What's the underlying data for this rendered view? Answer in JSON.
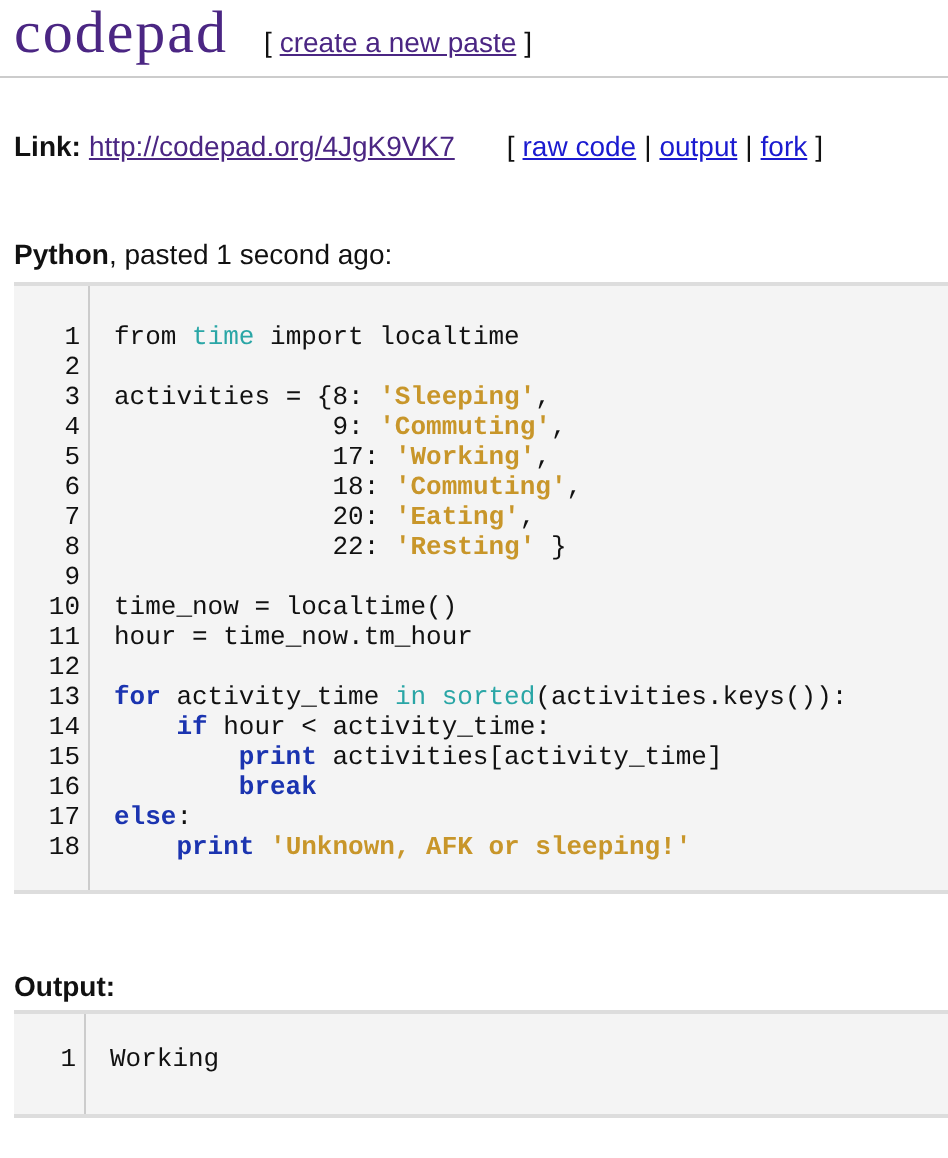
{
  "header": {
    "logo": "codepad",
    "bracket_open": "[",
    "new_paste_link": "create a new paste",
    "bracket_close": "]"
  },
  "link_row": {
    "label": "Link:",
    "url": "http://codepad.org/4JgK9VK7",
    "bracket_open": "[",
    "links": [
      {
        "text": "raw code"
      },
      {
        "text": "output"
      },
      {
        "text": "fork"
      }
    ],
    "separators": [
      "|",
      "|"
    ],
    "bracket_close": "]"
  },
  "paste_info": {
    "language": "Python",
    "rest": ", pasted 1 second ago:"
  },
  "code": {
    "lines": [
      {
        "number": "1",
        "tokens": [
          {
            "kind": "plain",
            "text": "from "
          },
          {
            "kind": "builtin",
            "text": "time"
          },
          {
            "kind": "plain",
            "text": " import localtime"
          }
        ]
      },
      {
        "number": "2"
      },
      {
        "number": "3",
        "tokens": [
          {
            "kind": "plain",
            "text": "activities = {8: "
          },
          {
            "kind": "string",
            "text": "'Sleeping'"
          },
          {
            "kind": "plain",
            "text": ","
          }
        ]
      },
      {
        "number": "4",
        "tokens": [
          {
            "kind": "plain",
            "text": "              9: "
          },
          {
            "kind": "string",
            "text": "'Commuting'"
          },
          {
            "kind": "plain",
            "text": ","
          }
        ]
      },
      {
        "number": "5",
        "tokens": [
          {
            "kind": "plain",
            "text": "              17: "
          },
          {
            "kind": "string",
            "text": "'Working'"
          },
          {
            "kind": "plain",
            "text": ","
          }
        ]
      },
      {
        "number": "6",
        "tokens": [
          {
            "kind": "plain",
            "text": "              18: "
          },
          {
            "kind": "string",
            "text": "'Commuting'"
          },
          {
            "kind": "plain",
            "text": ","
          }
        ]
      },
      {
        "number": "7",
        "tokens": [
          {
            "kind": "plain",
            "text": "              20: "
          },
          {
            "kind": "string",
            "text": "'Eating'"
          },
          {
            "kind": "plain",
            "text": ","
          }
        ]
      },
      {
        "number": "8",
        "tokens": [
          {
            "kind": "plain",
            "text": "              22: "
          },
          {
            "kind": "string",
            "text": "'Resting'"
          },
          {
            "kind": "plain",
            "text": " }"
          }
        ]
      },
      {
        "number": "9"
      },
      {
        "number": "10",
        "tokens": [
          {
            "kind": "plain",
            "text": "time_now = localtime()"
          }
        ]
      },
      {
        "number": "11",
        "tokens": [
          {
            "kind": "plain",
            "text": "hour = time_now.tm_hour"
          }
        ]
      },
      {
        "number": "12"
      },
      {
        "number": "13",
        "tokens": [
          {
            "kind": "keyword",
            "text": "for"
          },
          {
            "kind": "plain",
            "text": " activity_time "
          },
          {
            "kind": "builtin",
            "text": "in sorted"
          },
          {
            "kind": "plain",
            "text": "(activities.keys()):"
          }
        ],
        "children": [
          {
            "number": "14",
            "tokens": [
              {
                "kind": "keyword",
                "text": "if"
              },
              {
                "kind": "plain",
                "text": " hour < activity_time:"
              }
            ],
            "children": [
              {
                "number": "15",
                "tokens": [
                  {
                    "kind": "keyword",
                    "text": "print"
                  },
                  {
                    "kind": "plain",
                    "text": " activities[activity_time]"
                  }
                ]
              },
              {
                "number": "16",
                "tokens": [
                  {
                    "kind": "keyword",
                    "text": "break"
                  }
                ]
              }
            ]
          }
        ]
      },
      {
        "number": "17",
        "tokens": [
          {
            "kind": "keyword",
            "text": "else"
          },
          {
            "kind": "plain",
            "text": ":"
          }
        ],
        "children": [
          {
            "number": "18",
            "tokens": [
              {
                "kind": "keyword",
                "text": "print "
              },
              {
                "kind": "string",
                "text": "'Unknown, AFK or sleeping!'"
              }
            ]
          }
        ]
      }
    ]
  },
  "output": {
    "label": "Output:",
    "lines": [
      {
        "number": "1",
        "text": "Working"
      }
    ]
  }
}
